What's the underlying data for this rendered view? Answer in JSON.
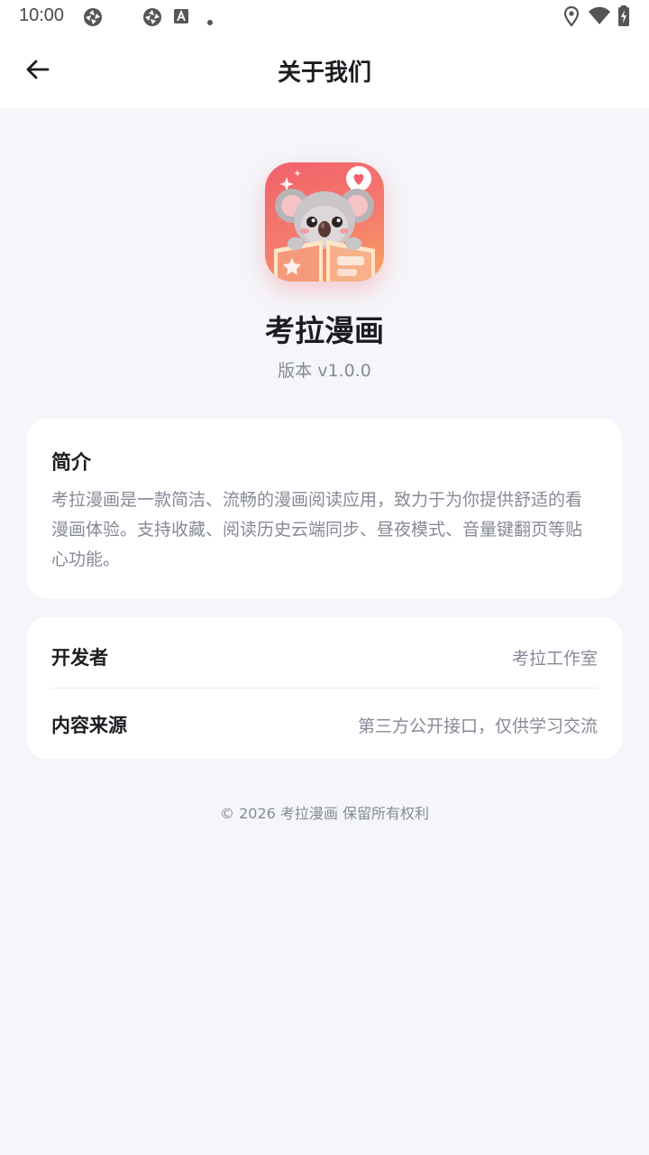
{
  "status_bar": {
    "time": "10:00",
    "icons": [
      "app-notification-icon",
      "app-notification-icon",
      "keyboard-a-icon",
      "dot-icon",
      "location-icon",
      "wifi-icon",
      "battery-charging-icon"
    ]
  },
  "header": {
    "title": "关于我们",
    "back_icon": "arrow-left-icon"
  },
  "app": {
    "logo": "koala-reading-logo",
    "name": "考拉漫画",
    "version": "版本 v1.0.0"
  },
  "intro": {
    "title": "简介",
    "body": "考拉漫画是一款简洁、流畅的漫画阅读应用，致力于为你提供舒适的看漫画体验。支持收藏、阅读历史云端同步、昼夜模式、音量键翻页等贴心功能。"
  },
  "info": {
    "developer_label": "开发者",
    "developer_value": "考拉工作室",
    "source_label": "内容来源",
    "source_value": "第三方公开接口，仅供学习交流"
  },
  "footer": {
    "copyright": "© 2026 考拉漫画  保留所有权利"
  },
  "colors": {
    "background": "#f5f6fa",
    "card": "#ffffff",
    "text_primary": "#1c1c22",
    "text_secondary": "#868a96",
    "logo_gradient_start": "#f2616b",
    "logo_gradient_end": "#f9a45e"
  }
}
